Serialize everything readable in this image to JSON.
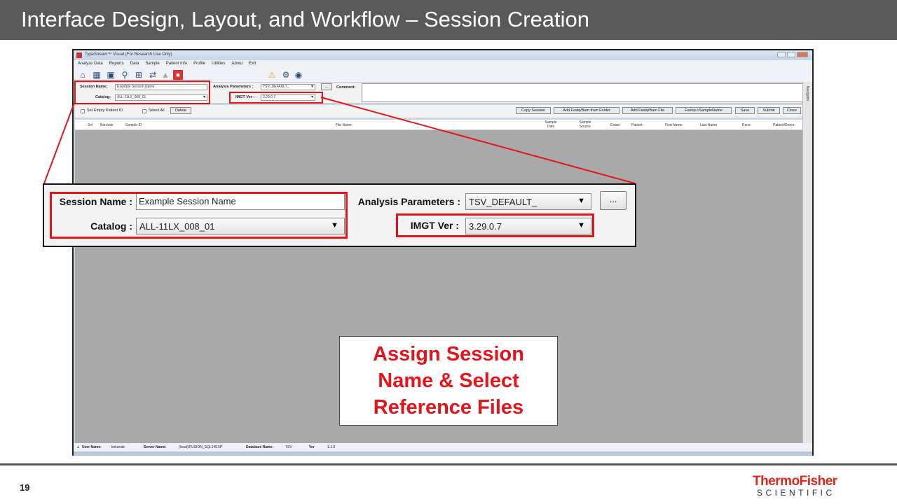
{
  "slide": {
    "title": "Interface Design, Layout, and Workflow – Session Creation",
    "page_number": "19",
    "logo_line1": "ThermoFisher",
    "logo_line2": "SCIENTIFIC",
    "accent_color": "#e3141b"
  },
  "app": {
    "window_title": "TypeStream™ Visual (For Research Use Only)",
    "menu": [
      "Analyze Data",
      "Reports",
      "Data",
      "Sample",
      "Patient Info",
      "Profile",
      "Utilities",
      "About",
      "Exit"
    ],
    "toolbar_icons": [
      "home-icon",
      "building-icon",
      "save-icon",
      "search-icon",
      "grid-icon",
      "connect-icon",
      "bell-icon",
      "alert-icon",
      "warning-icon",
      "gear-icon",
      "user-icon"
    ],
    "params": {
      "session_name_label": "Session Name:",
      "session_name_value": "Example Session Name",
      "catalog_label": "Catalog:",
      "catalog_value": "ALL-11LX_008_01",
      "analysis_params_label": "Analysis Parameters :",
      "analysis_params_value": "TSV_DEFAULT_",
      "imgt_label": "IMGT Ver :",
      "imgt_value": "3.29.0.7",
      "ellipsis": "...",
      "comment_label": "Comment:",
      "navigator": "Navigator"
    },
    "controls": {
      "set_empty_patient_id": "Set Empty Patient ID",
      "select_all": "Select All",
      "delete": "Delete",
      "buttons": [
        "Copy Session",
        "Add Fastq/Bam from Folder",
        "Add Fastq/Bam File",
        "Fastq<>SampleName",
        "Save",
        "Submit",
        "Close"
      ]
    },
    "grid_columns": [
      "Sel",
      "Barcode",
      "Sample ID",
      "File Name",
      "Sample Date",
      "Sample Source",
      "Exists",
      "Patient",
      "First Name",
      "Last Name",
      "Race",
      "Patient/Donor"
    ],
    "status": {
      "user_name_label": "User Name:",
      "user_name_value": "kekurutz",
      "server_name_label": "Server Name:",
      "server_name_value": "(local)\\FUSION_SQL14EXP",
      "database_name_label": "Database Name:",
      "database_name_value": "TSV",
      "ver_label": "Ver",
      "ver_value": "1.1.0"
    }
  },
  "zoom": {
    "session_name_label": "Session Name :",
    "session_name_value": "Example Session Name",
    "catalog_label": "Catalog :",
    "catalog_value": "ALL-11LX_008_01",
    "analysis_params_label": "Analysis Parameters :",
    "analysis_params_value": "TSV_DEFAULT_",
    "imgt_label": "IMGT Ver :",
    "imgt_value": "3.29.0.7",
    "ellipsis": "..."
  },
  "callout": {
    "line1": "Assign Session",
    "line2": "Name & Select",
    "line3": "Reference Files"
  }
}
